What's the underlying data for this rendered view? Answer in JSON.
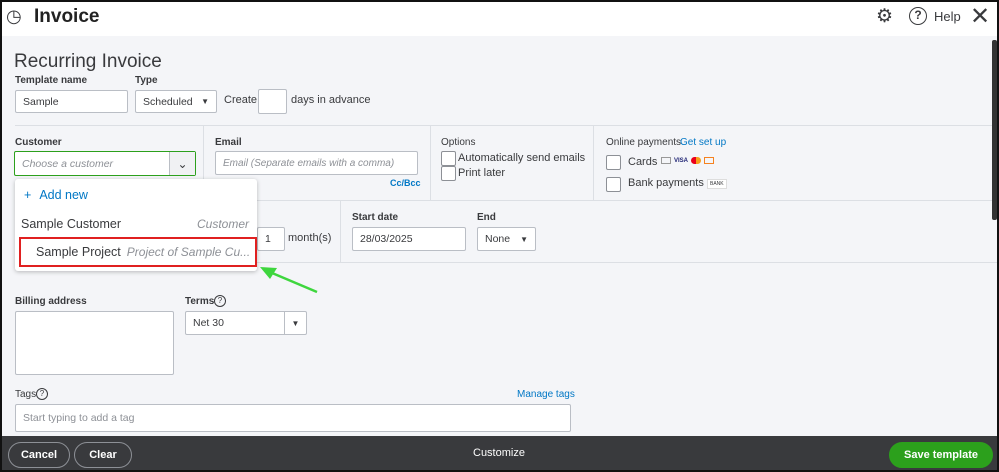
{
  "header": {
    "title": "Invoice",
    "help": "Help"
  },
  "form": {
    "heading": "Recurring Invoice",
    "template_name_label": "Template name",
    "template_name_value": "Sample",
    "type_label": "Type",
    "type_value": "Scheduled",
    "create_label": "Create",
    "create_value": "",
    "days_label": "days in advance"
  },
  "customer": {
    "label": "Customer",
    "placeholder": "Choose a customer"
  },
  "email": {
    "label": "Email",
    "placeholder": "Email (Separate emails with a comma)",
    "cc_bcc": "Cc/Bcc"
  },
  "options": {
    "label": "Options",
    "auto_send": "Automatically send emails",
    "print_later": "Print later"
  },
  "online_payments": {
    "label": "Online payments",
    "setup_link": "Get set up",
    "cards": "Cards",
    "bank": "Bank payments",
    "bank_badge": "BANK",
    "visa": "VISA"
  },
  "dropdown": {
    "add_new": "Add new",
    "items": [
      {
        "name": "Sample Customer",
        "type": "Customer"
      },
      {
        "name": "Sample Project",
        "type": "Project of Sample Cu..."
      }
    ]
  },
  "interval": {
    "every_value": "1",
    "unit": "month(s)",
    "start_label": "Start date",
    "start_value": "28/03/2025",
    "end_label": "End",
    "end_value": "None"
  },
  "billing": {
    "label": "Billing address",
    "terms_label": "Terms",
    "terms_value": "Net 30"
  },
  "tags": {
    "label": "Tags",
    "manage": "Manage tags",
    "placeholder": "Start typing to add a tag"
  },
  "footer": {
    "cancel": "Cancel",
    "clear": "Clear",
    "customize": "Customize",
    "save": "Save template"
  },
  "colors": {
    "green": "#2ca01c",
    "link": "#0077c5",
    "footer": "#393a3d",
    "highlight": "#e02020"
  }
}
